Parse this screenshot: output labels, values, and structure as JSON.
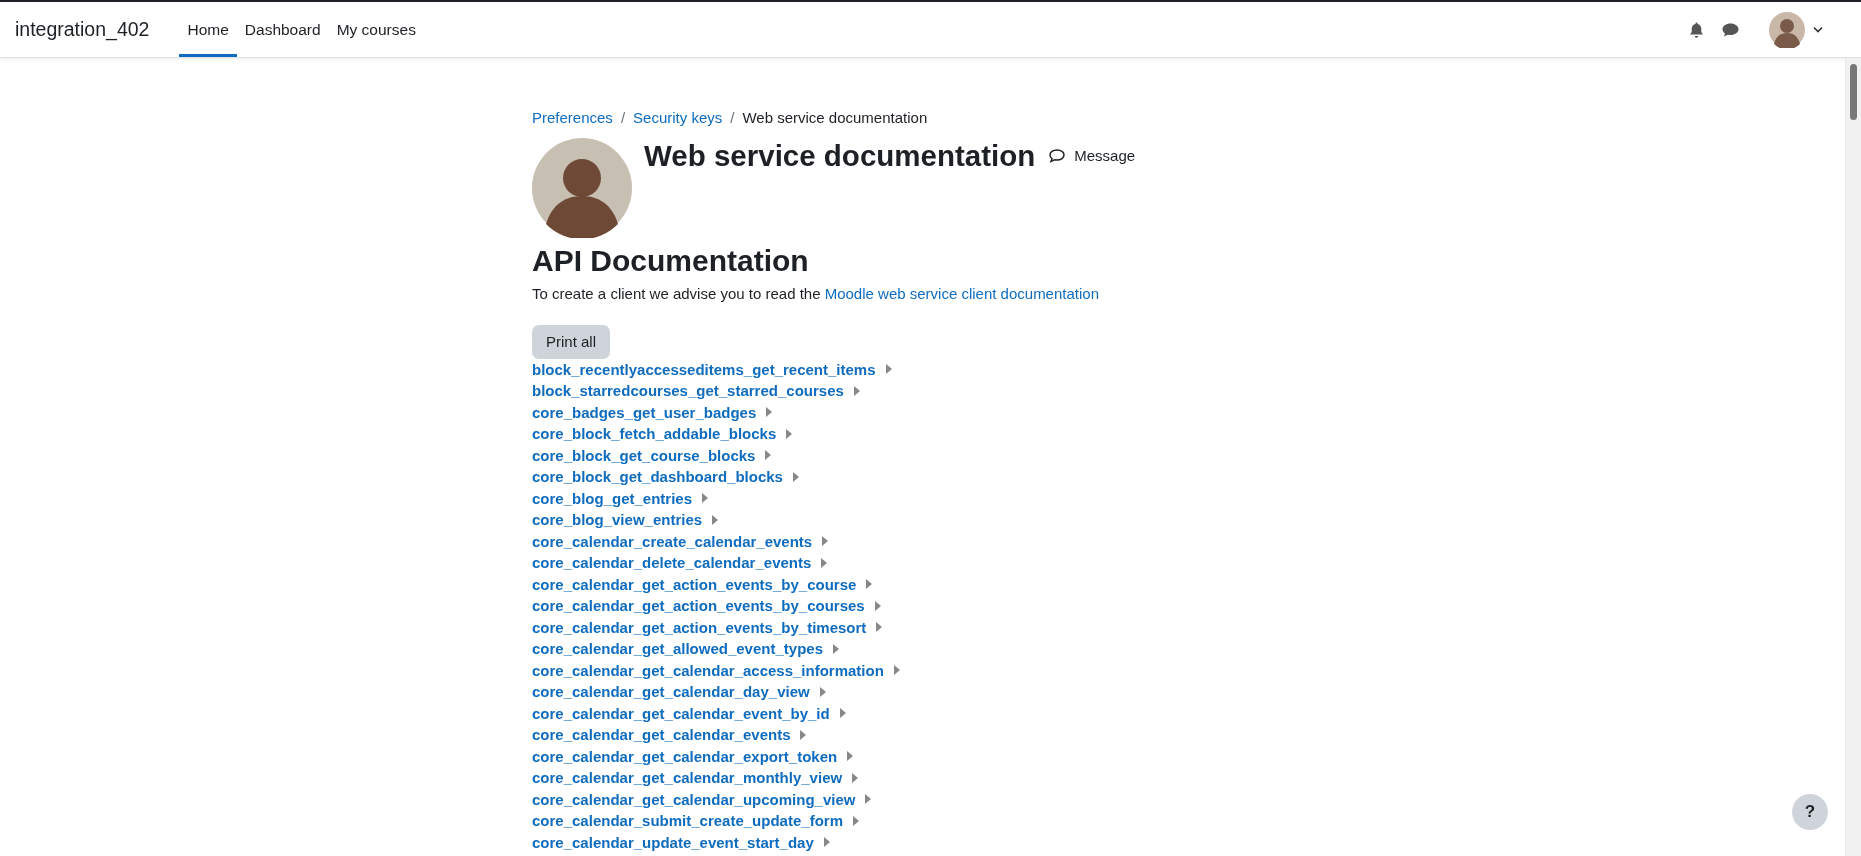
{
  "navbar": {
    "site_name": "integration_402",
    "tabs": [
      {
        "label": "Home",
        "selected": true
      },
      {
        "label": "Dashboard",
        "selected": false
      },
      {
        "label": "My courses",
        "selected": false
      }
    ]
  },
  "breadcrumb": [
    {
      "label": "Preferences",
      "kind": "link"
    },
    {
      "label": "Security keys",
      "kind": "link"
    },
    {
      "label": "Web service documentation",
      "kind": "current"
    }
  ],
  "breadcrumb_separators": [
    "/",
    "/"
  ],
  "page_title": "Web service documentation",
  "message_button": "Message",
  "section_title": "API Documentation",
  "intro": {
    "text": "To create a client we advise you to read the",
    "link": "Moodle web service client documentation"
  },
  "print_button": "Print all",
  "functions": [
    {
      "name": "block_recentlyaccesseditems_get_recent_items",
      "expanded": false
    },
    {
      "name": "block_starredcourses_get_starred_courses",
      "expanded": false
    },
    {
      "name": "core_badges_get_user_badges",
      "expanded": false
    },
    {
      "name": "core_block_fetch_addable_blocks",
      "expanded": false
    },
    {
      "name": "core_block_get_course_blocks",
      "expanded": false
    },
    {
      "name": "core_block_get_dashboard_blocks",
      "expanded": false
    },
    {
      "name": "core_blog_get_entries",
      "expanded": false
    },
    {
      "name": "core_blog_view_entries",
      "expanded": false
    },
    {
      "name": "core_calendar_create_calendar_events",
      "expanded": false
    },
    {
      "name": "core_calendar_delete_calendar_events",
      "expanded": false
    },
    {
      "name": "core_calendar_get_action_events_by_course",
      "expanded": false
    },
    {
      "name": "core_calendar_get_action_events_by_courses",
      "expanded": false
    },
    {
      "name": "core_calendar_get_action_events_by_timesort",
      "expanded": false
    },
    {
      "name": "core_calendar_get_allowed_event_types",
      "expanded": false
    },
    {
      "name": "core_calendar_get_calendar_access_information",
      "expanded": false
    },
    {
      "name": "core_calendar_get_calendar_day_view",
      "expanded": false
    },
    {
      "name": "core_calendar_get_calendar_event_by_id",
      "expanded": false
    },
    {
      "name": "core_calendar_get_calendar_events",
      "expanded": false
    },
    {
      "name": "core_calendar_get_calendar_export_token",
      "expanded": false
    },
    {
      "name": "core_calendar_get_calendar_monthly_view",
      "expanded": false
    },
    {
      "name": "core_calendar_get_calendar_upcoming_view",
      "expanded": false
    },
    {
      "name": "core_calendar_submit_create_update_form",
      "expanded": false
    },
    {
      "name": "core_calendar_update_event_start_day",
      "expanded": false
    }
  ],
  "help_button": "?"
}
